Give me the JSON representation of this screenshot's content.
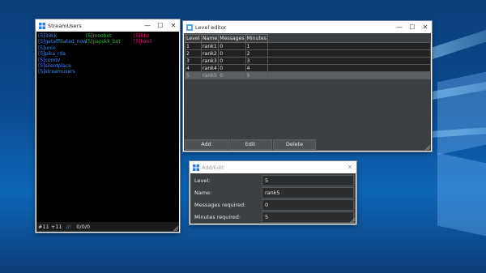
{
  "stream_users": {
    "title": "StreamUsers",
    "col1": [
      "[5]33kk",
      "[5]getaffiliated_now",
      "[5]unix",
      "[5]pika_rda",
      "[5]comtv",
      "[5]silentplace",
      "[5]streamusers"
    ],
    "col2": [
      "[5]moobot",
      "[5]papskk_bot"
    ],
    "col3": [
      "[5]ltbz",
      "[5]kenil"
    ],
    "status": "#11 +11",
    "status_count": "0/0/0",
    "colors": {
      "user": "#3a8bff",
      "bot": "#22c033",
      "mod": "#e0197d"
    }
  },
  "level_editor": {
    "title": "Level editor",
    "headers": [
      "Level",
      "Name",
      "Messages",
      "Minutes"
    ],
    "rows": [
      [
        "1",
        "rank1",
        "0",
        "1"
      ],
      [
        "2",
        "rank2",
        "0",
        "2"
      ],
      [
        "3",
        "rank3",
        "0",
        "3"
      ],
      [
        "4",
        "rank4",
        "0",
        "4"
      ],
      [
        "5",
        "rank5",
        "0",
        "5"
      ]
    ],
    "buttons": [
      "Add",
      "Edit",
      "Delete"
    ]
  },
  "add_edit": {
    "title": "Add/Edit",
    "fields": [
      {
        "label": "Level:",
        "value": "5"
      },
      {
        "label": "Name:",
        "value": "rank5"
      },
      {
        "label": "Messages required:",
        "value": "0"
      },
      {
        "label": "Minutes required:",
        "value": "5"
      }
    ]
  },
  "window_controls": {
    "minimize": "—",
    "maximize": "☐",
    "close": "✕"
  }
}
